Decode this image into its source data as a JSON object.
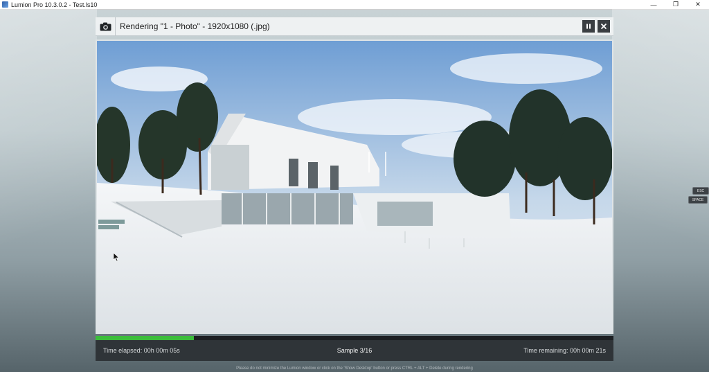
{
  "window": {
    "title": "Lumion Pro 10.3.0.2 - Test.ls10",
    "controls": {
      "minimize": "—",
      "restore": "❐",
      "close": "✕"
    }
  },
  "render": {
    "title": "Rendering \"1 - Photo\" - 1920x1080 (.jpg)",
    "progress_fraction": 0.19,
    "time_elapsed": "Time elapsed: 00h 00m 05s",
    "sample": "Sample 3/16",
    "time_remaining": "Time remaining: 00h 00m 21s",
    "pause_icon": "pause-icon",
    "close_icon": "close-icon",
    "camera_icon": "camera-icon"
  },
  "shortcuts": {
    "esc": "ESC",
    "space": "SPACE"
  },
  "notice": "Please do not minimize the Lumion window or click on the 'Show Desktop' button or press CTRL + ALT + Delete during rendering",
  "colors": {
    "progress": "#3bbd3b",
    "footer": "#2f3438",
    "header": "#eef1f2"
  }
}
